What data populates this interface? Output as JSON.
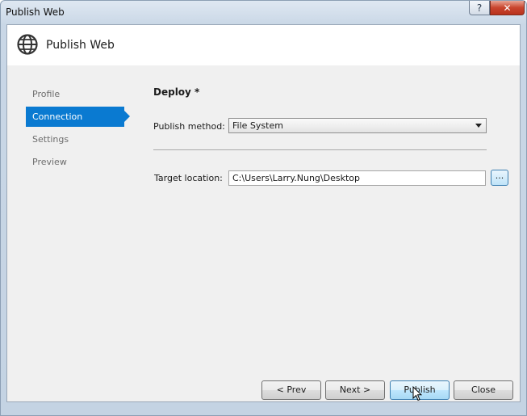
{
  "window": {
    "title": "Publish Web",
    "help_glyph": "?",
    "close_glyph": "✕"
  },
  "header": {
    "title": "Publish Web",
    "icon": "globe-icon"
  },
  "sidebar": {
    "items": [
      {
        "label": "Profile",
        "active": false
      },
      {
        "label": "Connection",
        "active": true
      },
      {
        "label": "Settings",
        "active": false
      },
      {
        "label": "Preview",
        "active": false
      }
    ]
  },
  "main": {
    "section_title": "Deploy *",
    "publish_method_label": "Publish method:",
    "publish_method_value": "File System",
    "target_location_label": "Target location:",
    "target_location_value": "C:\\Users\\Larry.Nung\\Desktop",
    "browse_label": "..."
  },
  "footer": {
    "prev_label": "< Prev",
    "next_label": "Next >",
    "publish_label": "Publish",
    "close_label": "Close"
  },
  "colors": {
    "accent": "#0a7ad1",
    "client_bg": "#f0f0f0",
    "header_bg": "#ffffff"
  }
}
